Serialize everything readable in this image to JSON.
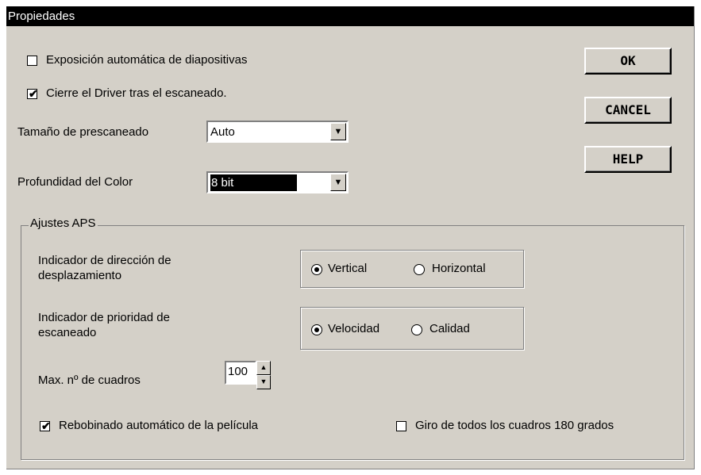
{
  "window": {
    "title": "Propiedades"
  },
  "options": {
    "auto_slide": {
      "label": "Exposición automática de diapositivas",
      "checked": false
    },
    "close_driver": {
      "label": "Cierre el Driver tras el escaneado.",
      "checked": true
    }
  },
  "prescan": {
    "label": "Tamaño de prescaneado",
    "value": "Auto"
  },
  "color_depth": {
    "label": "Profundidad del Color",
    "value": "8 bit"
  },
  "buttons": {
    "ok": "OK",
    "cancel": "CANCEL",
    "help": "HELP"
  },
  "aps": {
    "title": "Ajustes APS",
    "direction": {
      "label_line1": "Indicador de dirección de",
      "label_line2": "desplazamiento",
      "options": [
        "Vertical",
        "Horizontal"
      ],
      "selected": "Vertical"
    },
    "priority": {
      "label_line1": "Indicador de prioridad de",
      "label_line2": "escaneado",
      "options": [
        "Velocidad",
        "Calidad"
      ],
      "selected": "Velocidad"
    },
    "max_frames": {
      "label": "Max. nº de cuadros",
      "value": "100"
    },
    "auto_rewind": {
      "label": "Rebobinado automático de la película",
      "checked": true
    },
    "rotate_all": {
      "label": "Giro de todos los cuadros 180 grados",
      "checked": false
    }
  },
  "icons": {
    "checkmark": "✔",
    "dropdown": "▼",
    "spin_up": "▲",
    "spin_down": "▼"
  }
}
